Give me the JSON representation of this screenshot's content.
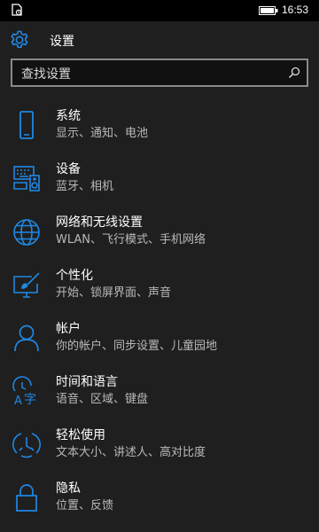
{
  "status_bar": {
    "time": "16:53"
  },
  "header": {
    "title": "设置"
  },
  "search": {
    "placeholder": "查找设置"
  },
  "accent_color": "#1e88e5",
  "items": [
    {
      "title": "系统",
      "subtitle": "显示、通知、电池",
      "icon": "phone-icon"
    },
    {
      "title": "设备",
      "subtitle": "蓝牙、相机",
      "icon": "devices-icon"
    },
    {
      "title": "网络和无线设置",
      "subtitle": "WLAN、飞行模式、手机网络",
      "icon": "globe-icon"
    },
    {
      "title": "个性化",
      "subtitle": "开始、锁屏界面、声音",
      "icon": "personalization-icon"
    },
    {
      "title": "帐户",
      "subtitle": "你的帐户、同步设置、儿童园地",
      "icon": "person-icon"
    },
    {
      "title": "时间和语言",
      "subtitle": "语音、区域、键盘",
      "icon": "language-icon"
    },
    {
      "title": "轻松使用",
      "subtitle": "文本大小、讲述人、高对比度",
      "icon": "ease-of-access-icon"
    },
    {
      "title": "隐私",
      "subtitle": "位置、反馈",
      "icon": "lock-icon"
    }
  ]
}
